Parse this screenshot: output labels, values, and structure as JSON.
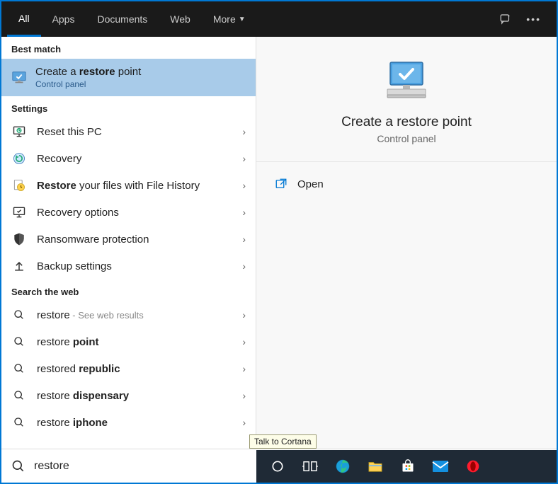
{
  "tabs": {
    "all": "All",
    "apps": "Apps",
    "documents": "Documents",
    "web": "Web",
    "more": "More"
  },
  "sections": {
    "best": "Best match",
    "settings": "Settings",
    "web": "Search the web"
  },
  "best": {
    "title_pre": "Create a ",
    "title_bold": "restore",
    "title_post": " point",
    "subtitle": "Control panel"
  },
  "settings_items": {
    "reset": "Reset this PC",
    "recovery": "Recovery",
    "filehistory_bold": "Restore",
    "filehistory_rest": " your files with File History",
    "recovery_options": "Recovery options",
    "ransomware": "Ransomware protection",
    "backup": "Backup settings"
  },
  "web_items": {
    "r0_pre": "restore",
    "r0_hint": " - See web results",
    "r1_pre": "restore ",
    "r1_bold": "point",
    "r2_pre": "restored ",
    "r2_bold": "republic",
    "r3_pre": "restore ",
    "r3_bold": "dispensary",
    "r4_pre": "restore ",
    "r4_bold": "iphone"
  },
  "preview": {
    "title": "Create a restore point",
    "subtitle": "Control panel",
    "open": "Open"
  },
  "tooltip": "Talk to Cortana",
  "search": {
    "value": "restore"
  }
}
